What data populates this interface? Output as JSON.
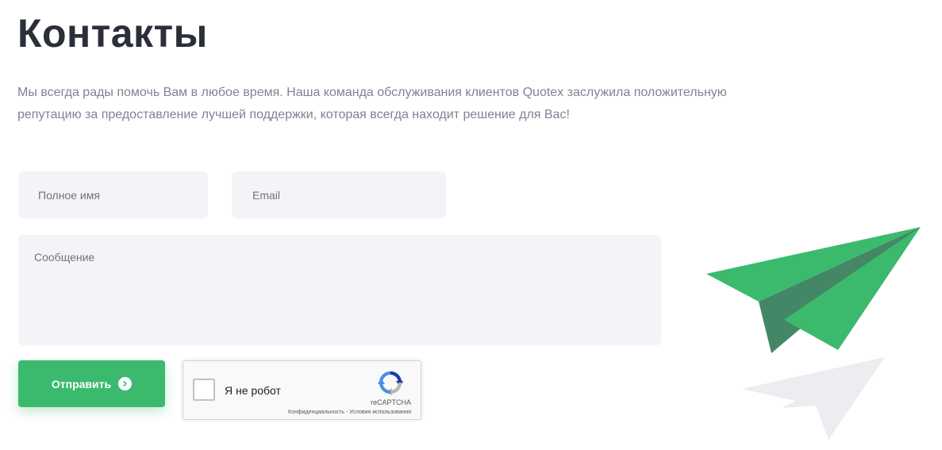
{
  "page": {
    "title": "Контакты",
    "intro_line1": "Мы всегда рады помочь Вам в любое время. Наша команда обслуживания клиентов Quotex заслужила положительную",
    "intro_line2": "репутацию за предоставление лучшей поддержки, которая всегда находит решение для Вас!"
  },
  "form": {
    "name_placeholder": "Полное имя",
    "name_value": "",
    "email_placeholder": "Email",
    "email_value": "",
    "message_placeholder": "Сообщение",
    "message_value": "",
    "submit_label": "Отправить",
    "submit_icon": "arrow-right-circle-icon"
  },
  "recaptcha": {
    "label": "Я не робот",
    "checked": false,
    "brand": "reCAPTCHA",
    "privacy_link": "Конфиденциальность",
    "separator": "-",
    "terms_link": "Условия использования",
    "logo_icon": "recaptcha-logo-icon"
  },
  "decoration": {
    "icon": "paper-plane-icon",
    "primary_color": "#3bba6e",
    "fold_color": "#448766",
    "shadow_plane_color": "#ebedf0"
  },
  "colors": {
    "accent": "#3bba6e",
    "title": "#2b2f3a",
    "body_text": "#7f8393",
    "field_bg": "#f5f3f8"
  }
}
